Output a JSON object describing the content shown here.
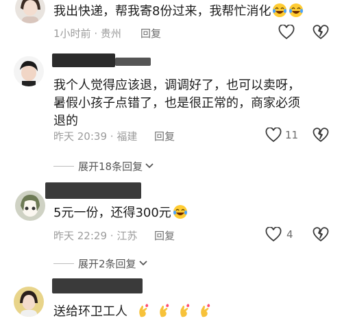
{
  "comments": [
    {
      "text": "我出快递，帮我寄8份过来，我帮忙消化",
      "emoji": "😂😂",
      "time": "1小时前",
      "location": "贵州",
      "reply_label": "回复",
      "likes": ""
    },
    {
      "name": "",
      "text_lines": [
        "我个人觉得应该退，调调好了，也可以卖呀，",
        "暑假小孩子点错了，也是很正常的，商家必须",
        "退的"
      ],
      "time": "昨天 20:39",
      "location": "福建",
      "reply_label": "回复",
      "likes": "11"
    },
    {
      "name": "",
      "text": "5元一份，还得300元",
      "emoji": "😂",
      "time": "昨天 22:29",
      "location": "江苏",
      "reply_label": "回复",
      "likes": "4"
    },
    {
      "name": "",
      "text": "送给环卫工人",
      "emoji": "🫰🫰🫰🫰"
    }
  ],
  "expand_1": "展开18条回复",
  "expand_2": "展开2条回复",
  "separator": "·",
  "icons": {
    "like": "heart-outline-icon",
    "dislike": "broken-heart-icon",
    "expand": "chevron-down-icon"
  },
  "colors": {
    "meta": "#9b9b9b",
    "name_redaction": "#2b2b2b"
  }
}
